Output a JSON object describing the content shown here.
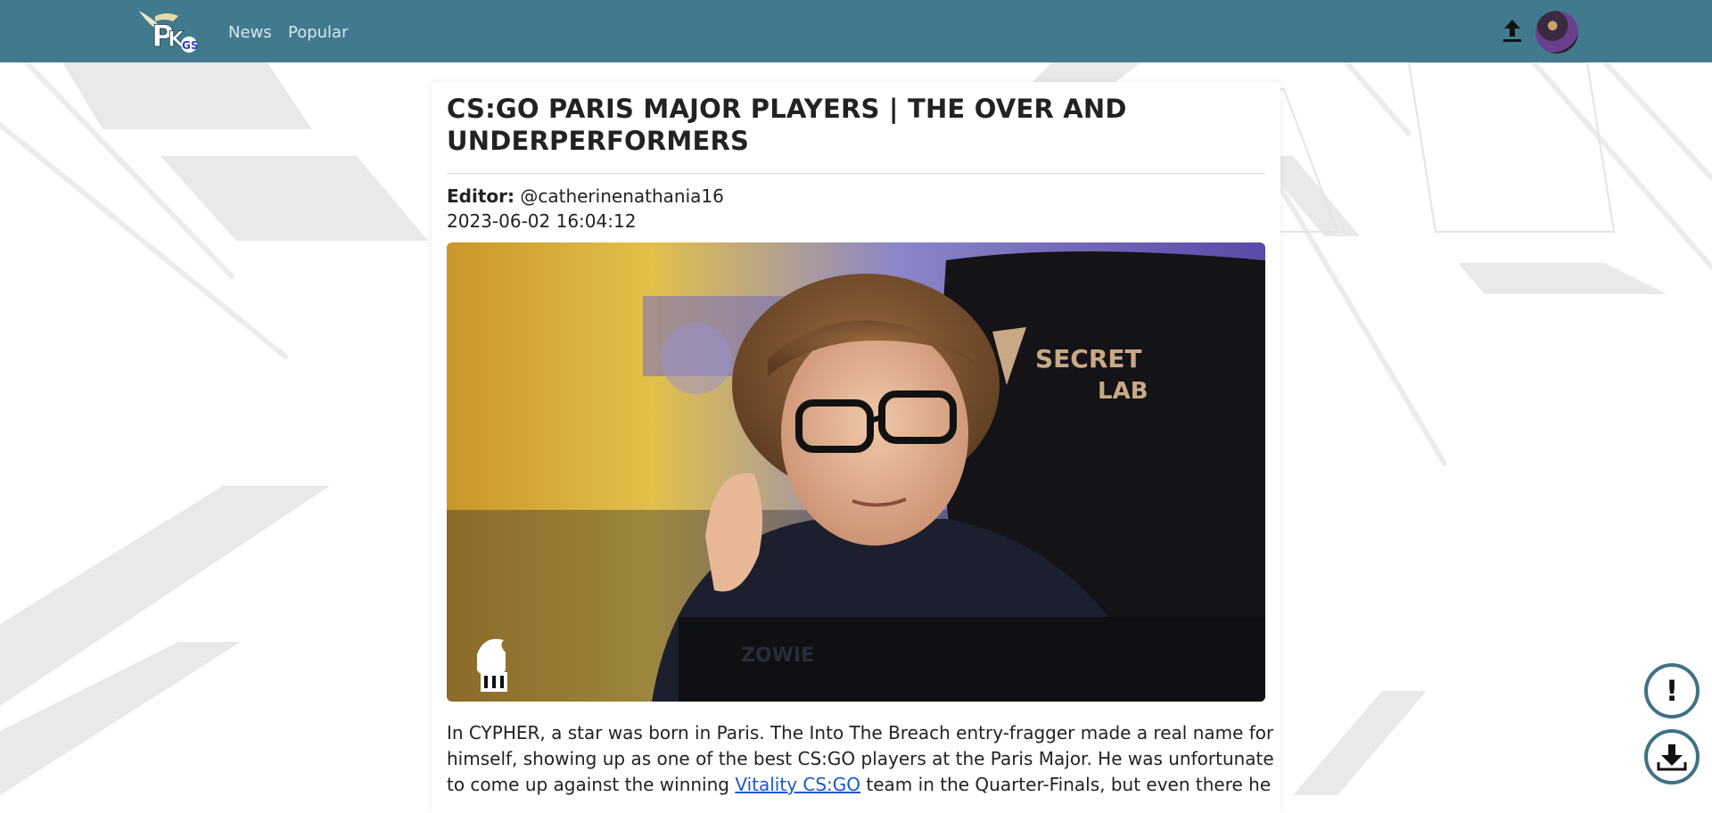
{
  "nav": {
    "links": [
      "News",
      "Popular"
    ]
  },
  "article": {
    "title": "CS:GO PARIS MAJOR PLAYERS | THE OVER AND UNDERPERFORMERS",
    "editor_label": "Editor:",
    "editor_handle": "@catherinenathania16",
    "timestamp": "2023-06-02 16:04:12",
    "body_before_link": "In CYPHER, a star was born in Paris. The Into The Breach entry-fragger made a real name for himself, showing up as one of the best CS:GO players at the Paris Major. He was unfortunate to come up against the winning ",
    "body_link": "Vitality CS:GO",
    "body_after_link": " team in the Quarter-Finals, but even there he"
  },
  "fab": {
    "report_glyph": "!"
  },
  "colors": {
    "navbar": "#417a8f",
    "accent_border": "#3f7185",
    "link": "#1a56d6"
  },
  "icons": {
    "logo": "site-logo",
    "upload": "upload-icon",
    "avatar": "user-avatar",
    "report": "report-icon",
    "download": "download-icon"
  }
}
